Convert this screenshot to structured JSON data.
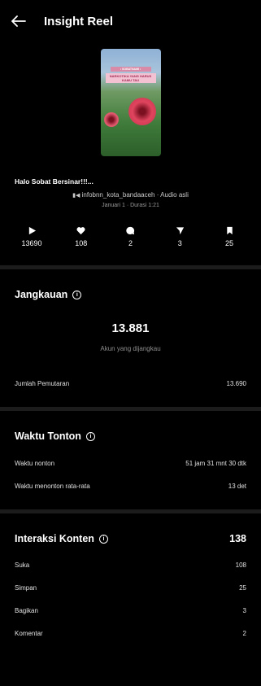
{
  "header": {
    "title": "Insight Reel"
  },
  "thumbnail": {
    "tag_top": "• SOBATNAMI •",
    "tag_main": "NARKOTIKA YANG HARUS KAMU TAU"
  },
  "post": {
    "caption": "Halo Sobat Bersinar!!!...",
    "audio": "infobnn_kota_bandaaceh · Audio asli",
    "meta": "Januari 1 · Durasi 1:21"
  },
  "stats": [
    {
      "icon": "play-icon",
      "value": "13690"
    },
    {
      "icon": "heart-icon",
      "value": "108"
    },
    {
      "icon": "comment-icon",
      "value": "2"
    },
    {
      "icon": "share-icon",
      "value": "3"
    },
    {
      "icon": "bookmark-icon",
      "value": "25"
    }
  ],
  "reach": {
    "title": "Jangkauan",
    "value": "13.881",
    "label": "Akun yang dijangkau",
    "rows": [
      {
        "label": "Jumlah Pemutaran",
        "value": "13.690"
      }
    ]
  },
  "watch": {
    "title": "Waktu Tonton",
    "rows": [
      {
        "label": "Waktu nonton",
        "value": "51 jam 31 mnt 30 dtk"
      },
      {
        "label": "Waktu menonton rata-rata",
        "value": "13 det"
      }
    ]
  },
  "interaction": {
    "title": "Interaksi Konten",
    "total": "138",
    "rows": [
      {
        "label": "Suka",
        "value": "108"
      },
      {
        "label": "Simpan",
        "value": "25"
      },
      {
        "label": "Bagikan",
        "value": "3"
      },
      {
        "label": "Komentar",
        "value": "2"
      }
    ]
  }
}
